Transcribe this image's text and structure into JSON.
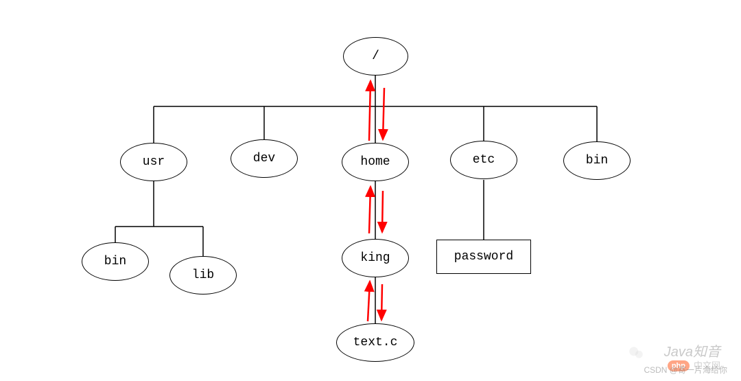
{
  "nodes": {
    "root": "/",
    "usr": "usr",
    "dev": "dev",
    "home": "home",
    "etc": "etc",
    "bin_top": "bin",
    "bin_child": "bin",
    "lib": "lib",
    "king": "king",
    "textc": "text.c",
    "password": "password"
  },
  "tree": {
    "root": {
      "label": "/",
      "children": [
        "usr",
        "dev",
        "home",
        "etc",
        "bin"
      ]
    },
    "usr": {
      "children": [
        "bin",
        "lib"
      ]
    },
    "dev": {
      "children": []
    },
    "home": {
      "children": [
        "king"
      ]
    },
    "etc": {
      "children": [
        "password"
      ]
    },
    "bin": {
      "children": []
    },
    "king": {
      "children": [
        "text.c"
      ]
    }
  },
  "arrows_highlighted_path": [
    "/",
    "home",
    "king",
    "text.c"
  ],
  "watermarks": {
    "java": "Java知音",
    "csdn": "CSDN @寄一片海给你",
    "cn": "中文网",
    "php": "php"
  }
}
